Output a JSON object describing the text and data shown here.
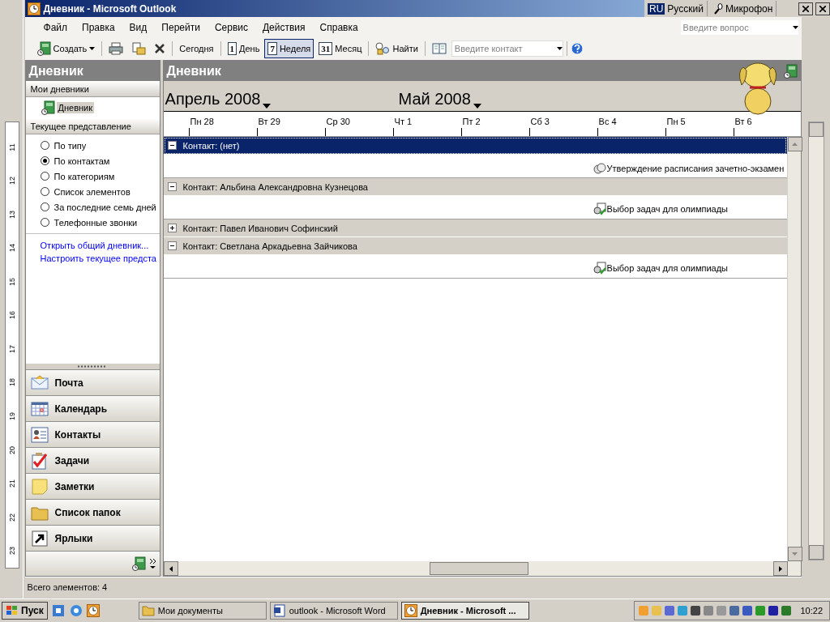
{
  "background_window": {
    "ruler_numbers": [
      "11",
      "12",
      "13",
      "14",
      "15",
      "16",
      "17",
      "18",
      "19",
      "20",
      "21",
      "22",
      "23"
    ]
  },
  "window": {
    "title": "Дневник - Microsoft Outlook"
  },
  "language_bar": {
    "language_code": "RU",
    "language": "Русский",
    "microphone": "Микрофон"
  },
  "menu": [
    "Файл",
    "Правка",
    "Вид",
    "Перейти",
    "Сервис",
    "Действия",
    "Справка"
  ],
  "help_search": {
    "placeholder": "Введите вопрос"
  },
  "toolbar": {
    "items": [
      {
        "kind": "new",
        "label": "Создать"
      },
      {
        "kind": "print"
      },
      {
        "kind": "move"
      },
      {
        "kind": "delete"
      },
      {
        "kind": "text",
        "label": "Сегодня"
      },
      {
        "kind": "view",
        "number": "1",
        "label": "День",
        "selected": false
      },
      {
        "kind": "view",
        "number": "7",
        "label": "Неделя",
        "selected": true
      },
      {
        "kind": "view",
        "number": "31",
        "label": "Месяц",
        "selected": false
      },
      {
        "kind": "find",
        "label": "Найти"
      },
      {
        "kind": "addressbook"
      }
    ],
    "contact_search": {
      "placeholder": "Введите контакт"
    }
  },
  "navigation_pane": {
    "title": "Дневник",
    "my_journals_header": "Мои дневники",
    "journals": [
      {
        "label": "Дневник",
        "selected": true
      }
    ],
    "current_view_header": "Текущее представление",
    "views": [
      {
        "label": "По типу",
        "selected": false
      },
      {
        "label": "По контактам",
        "selected": true
      },
      {
        "label": "По категориям",
        "selected": false
      },
      {
        "label": "Список элементов",
        "selected": false
      },
      {
        "label": "За последние семь дней",
        "selected": false
      },
      {
        "label": "Телефонные звонки",
        "selected": false
      }
    ],
    "links": [
      "Открыть общий дневник...",
      "Настроить текущее предста"
    ],
    "buttons": [
      {
        "kind": "mail",
        "label": "Почта"
      },
      {
        "kind": "calendar",
        "label": "Календарь"
      },
      {
        "kind": "contacts",
        "label": "Контакты"
      },
      {
        "kind": "tasks",
        "label": "Задачи"
      },
      {
        "kind": "notes",
        "label": "Заметки"
      },
      {
        "kind": "folders",
        "label": "Список папок"
      },
      {
        "kind": "shortcuts",
        "label": "Ярлыки"
      }
    ]
  },
  "journal": {
    "title": "Дневник",
    "months": [
      "Апрель 2008",
      "Май 2008"
    ],
    "days": [
      "Пн 28",
      "Вт 29",
      "Ср 30",
      "Чт 1",
      "Пт 2",
      "Сб 3",
      "Вс 4",
      "Пн 5",
      "Вт 6"
    ],
    "groups": [
      {
        "label": "Контакт: (нет)",
        "expanded": true,
        "selected": true,
        "entries": [
          {
            "kind": "meeting",
            "label": "Утверждение расписания зачетно-экзамен"
          }
        ]
      },
      {
        "label": "Контакт: Альбина Александровна Кузнецова",
        "expanded": true,
        "selected": false,
        "entries": [
          {
            "kind": "task",
            "label": "Выбор задач для олимпиады"
          }
        ]
      },
      {
        "label": "Контакт: Павел Иванович Софинский",
        "expanded": false,
        "selected": false
      },
      {
        "label": "Контакт: Светлана Аркадьевна Зайчикова",
        "expanded": true,
        "selected": false,
        "entries": [
          {
            "kind": "task",
            "label": "Выбор задач для олимпиады"
          }
        ]
      }
    ]
  },
  "status_bar": {
    "text": "Всего элементов: 4"
  },
  "taskbar": {
    "start": "Пуск",
    "tasks": [
      {
        "kind": "folder",
        "label": "Мои документы",
        "selected": false
      },
      {
        "kind": "word",
        "label": "outlook - Microsoft Word",
        "selected": false
      },
      {
        "kind": "outlook",
        "label": "Дневник - Microsoft ...",
        "selected": true
      }
    ],
    "clock": "10:22"
  }
}
